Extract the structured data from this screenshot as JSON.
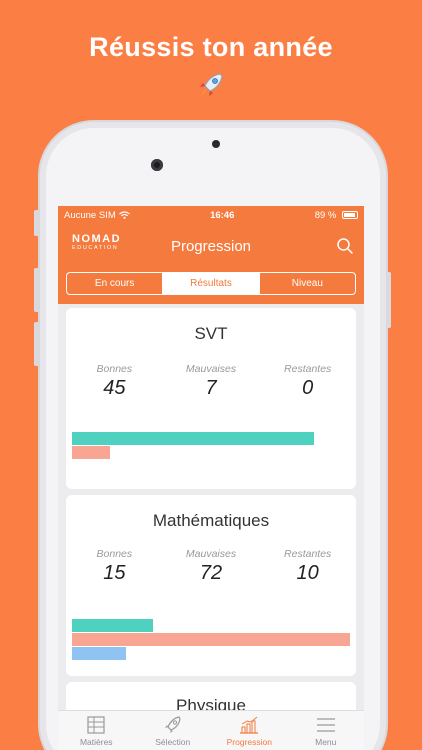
{
  "promo": {
    "title": "Réussis ton année"
  },
  "status": {
    "carrier": "Aucune SIM",
    "time": "16:46",
    "battery": "89 %"
  },
  "nav": {
    "logo_top": "NOMAD",
    "logo_bottom": "EDUCATION",
    "title": "Progression"
  },
  "segments": [
    "En cours",
    "Résultats",
    "Niveau"
  ],
  "subjects": [
    {
      "name": "SVT",
      "labels": [
        "Bonnes",
        "Mauvaises",
        "Restantes"
      ],
      "good": 45,
      "bad": 7,
      "remaining": 0
    },
    {
      "name": "Mathématiques",
      "labels": [
        "Bonnes",
        "Mauvaises",
        "Restantes"
      ],
      "good": 15,
      "bad": 72,
      "remaining": 10
    },
    {
      "name": "Physique"
    }
  ],
  "tabs": [
    {
      "label": "Matières",
      "icon": "books-icon"
    },
    {
      "label": "Sélection",
      "icon": "rocket-icon"
    },
    {
      "label": "Progression",
      "icon": "chart-icon"
    },
    {
      "label": "Menu",
      "icon": "hamburger-icon"
    }
  ],
  "colors": {
    "brand": "#f57a3e",
    "good": "#4fd1c0",
    "bad": "#f9a593",
    "remaining": "#8fc3f2"
  }
}
